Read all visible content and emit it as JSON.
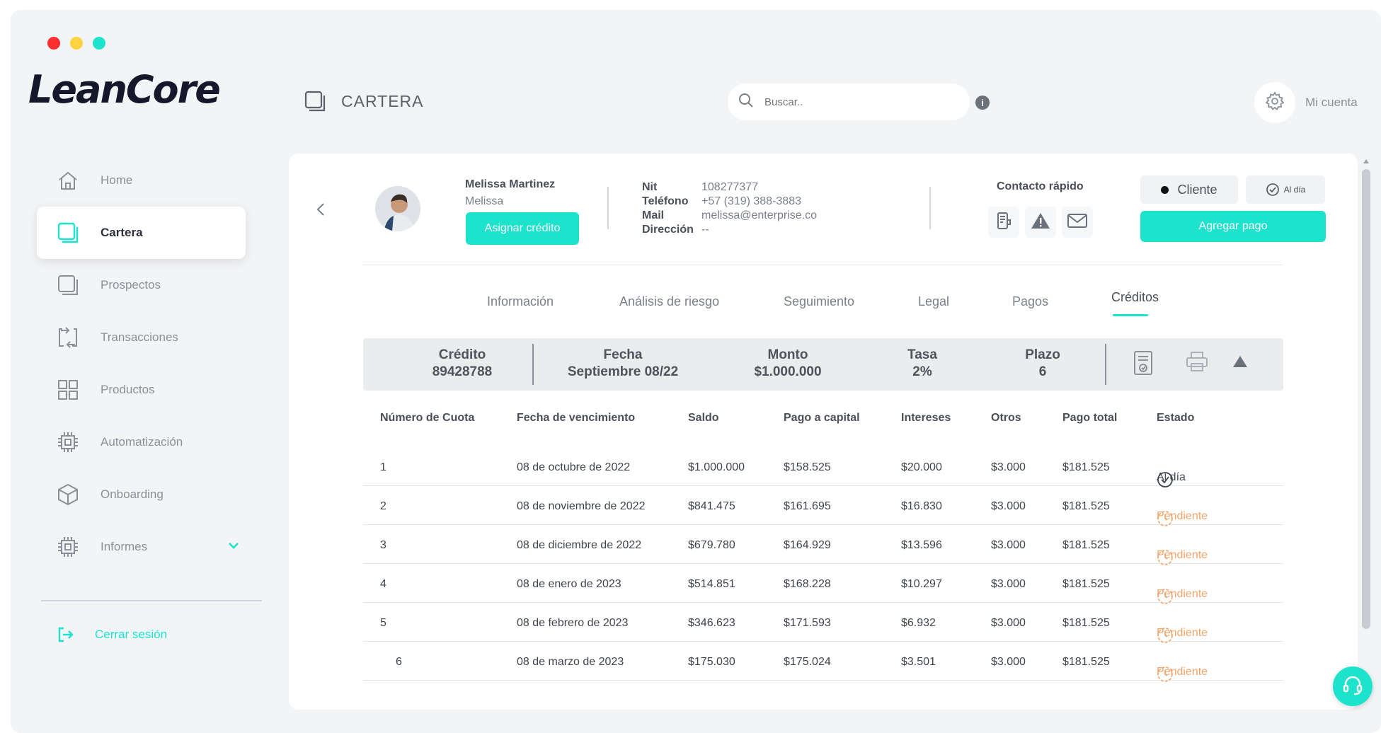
{
  "app": {
    "logo": "LeanCore",
    "section_title": "CARTERA",
    "search_placeholder": "Buscar..",
    "info_label": "i",
    "account_label": "Mi cuenta"
  },
  "window_dots": [
    "#ff2d2d",
    "#ffd23f",
    "#1de3cd"
  ],
  "accent_color": "#1de3cd",
  "pending_color": "#f3a56b",
  "sidebar": {
    "items": [
      {
        "label": "Home",
        "icon": "home-icon"
      },
      {
        "label": "Cartera",
        "icon": "wallet-icon",
        "active": true
      },
      {
        "label": "Prospectos",
        "icon": "prospects-icon"
      },
      {
        "label": "Transacciones",
        "icon": "transactions-icon"
      },
      {
        "label": "Productos",
        "icon": "grid-icon"
      },
      {
        "label": "Automatización",
        "icon": "chip-icon"
      },
      {
        "label": "Onboarding",
        "icon": "box-icon"
      },
      {
        "label": "Informes",
        "icon": "chip-icon",
        "expandable": true
      }
    ],
    "logout_label": "Cerrar sesión"
  },
  "client": {
    "name": "Melissa Martinez",
    "first_name": "Melissa",
    "assign_button": "Asignar crédito",
    "nit_label": "Nit",
    "nit": "108277377",
    "phone_label": "Teléfono",
    "phone": "+57 (319) 388-3883",
    "mail_label": "Mail",
    "mail": "melissa@enterprise.co",
    "address_label": "Dirección",
    "address": "--",
    "quick_contact_title": "Contacto rápido",
    "type_badge": "Cliente",
    "status_badge": "Al día",
    "add_payment_button": "Agregar pago"
  },
  "tabs": [
    {
      "label": "Información"
    },
    {
      "label": "Análisis de riesgo"
    },
    {
      "label": "Seguimiento"
    },
    {
      "label": "Legal"
    },
    {
      "label": "Pagos"
    },
    {
      "label": "Créditos",
      "active": true
    }
  ],
  "credit_summary": {
    "credit_label": "Crédito",
    "credit_value": "89428788",
    "date_label": "Fecha",
    "date_value": "Septiembre 08/22",
    "amount_label": "Monto",
    "amount_value": "$1.000.000",
    "rate_label": "Tasa",
    "rate_value": "2%",
    "term_label": "Plazo",
    "term_value": "6"
  },
  "table": {
    "headers": [
      "Número de Cuota",
      "Fecha de vencimiento",
      "Saldo",
      "Pago a capital",
      "Intereses",
      "Otros",
      "Pago total",
      "Estado"
    ],
    "rows": [
      {
        "num": "1",
        "due": "08 de octubre de 2022",
        "balance": "$1.000.000",
        "capital": "$158.525",
        "interest": "$20.000",
        "other": "$3.000",
        "total": "$181.525",
        "status": "Al día",
        "state": "ok"
      },
      {
        "num": "2",
        "due": "08 de noviembre de 2022",
        "balance": "$841.475",
        "capital": "$161.695",
        "interest": "$16.830",
        "other": "$3.000",
        "total": "$181.525",
        "status": "Pendiente",
        "state": "pend"
      },
      {
        "num": "3",
        "due": "08 de diciembre de 2022",
        "balance": "$679.780",
        "capital": "$164.929",
        "interest": "$13.596",
        "other": "$3.000",
        "total": "$181.525",
        "status": "Pendiente",
        "state": "pend"
      },
      {
        "num": "4",
        "due": "08 de enero de 2023",
        "balance": "$514.851",
        "capital": "$168.228",
        "interest": "$10.297",
        "other": "$3.000",
        "total": "$181.525",
        "status": "Pendiente",
        "state": "pend"
      },
      {
        "num": "5",
        "due": "08 de febrero de 2023",
        "balance": "$346.623",
        "capital": "$171.593",
        "interest": "$6.932",
        "other": "$3.000",
        "total": "$181.525",
        "status": "Pendiente",
        "state": "pend"
      },
      {
        "num": "6",
        "due": "08 de marzo de 2023",
        "balance": "$175.030",
        "capital": "$175.024",
        "interest": "$3.501",
        "other": "$3.000",
        "total": "$181.525",
        "status": "Pendiente",
        "state": "pend"
      }
    ]
  }
}
